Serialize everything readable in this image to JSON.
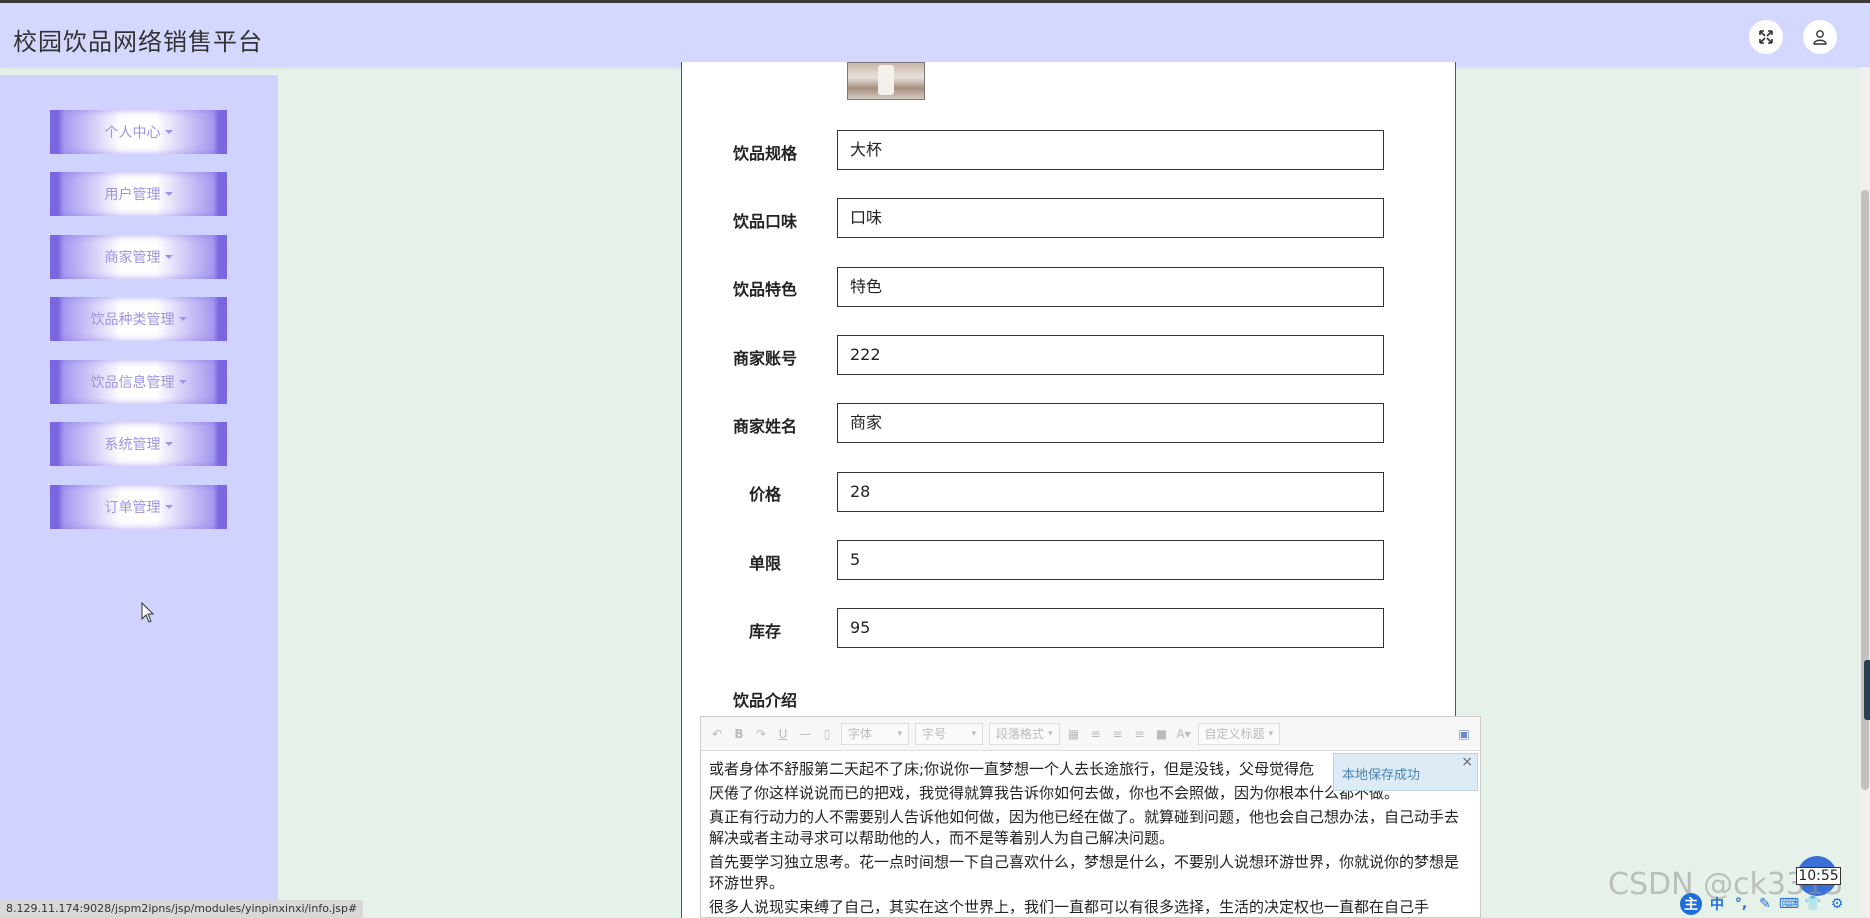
{
  "header": {
    "title": "校园饮品网络销售平台",
    "fullscreen_icon": "expand-arrows-icon",
    "user_icon": "user-icon"
  },
  "sidebar": {
    "items": [
      {
        "label": "个人中心"
      },
      {
        "label": "用户管理"
      },
      {
        "label": "商家管理"
      },
      {
        "label": "饮品种类管理"
      },
      {
        "label": "饮品信息管理"
      },
      {
        "label": "系统管理"
      },
      {
        "label": "订单管理"
      }
    ]
  },
  "form": {
    "fields": [
      {
        "label": "饮品规格",
        "value": "大杯"
      },
      {
        "label": "饮品口味",
        "value": "口味"
      },
      {
        "label": "饮品特色",
        "value": "特色"
      },
      {
        "label": "商家账号",
        "value": "222"
      },
      {
        "label": "商家姓名",
        "value": "商家"
      },
      {
        "label": "价格",
        "value": "28"
      },
      {
        "label": "单限",
        "value": "5"
      },
      {
        "label": "库存",
        "value": "95"
      }
    ],
    "intro_label": "饮品介绍"
  },
  "editor": {
    "toolbar": {
      "font": "字体",
      "size": "字号",
      "paragraph": "段落格式",
      "custom_title": "自定义标题"
    },
    "paragraphs": [
      "或者身体不舒服第二天起不了床;你说你一直梦想一个人去长途旅行，但是没钱，父母觉得危",
      "厌倦了你这样说说而已的把戏，我觉得就算我告诉你如何去做，你也不会照做，因为你根本什么都不做。",
      "真正有行动力的人不需要别人告诉他如何做，因为他已经在做了。就算碰到问题，他也会自己想办法，自己动手去解决或者主动寻求可以帮助他的人，而不是等着别人为自己解决问题。",
      "首先要学习独立思考。花一点时间想一下自己喜欢什么，梦想是什么，不要别人说想环游世界，你就说你的梦想是环游世界。",
      "很多人说现实束缚了自己，其实在这个世界上，我们一直都可以有很多选择，生活的决定权也一直都在自己手"
    ],
    "toast": "本地保存成功"
  },
  "statusbar": {
    "url": "8.129.11.174:9028/jspm2ipns/jsp/modules/yinpinxinxi/info.jsp#"
  },
  "watermark": "CSDN @ck3313",
  "clock": "10:55",
  "ime": [
    "主",
    "中",
    "°,",
    "✎",
    "⌨",
    "👕",
    "⚙"
  ]
}
